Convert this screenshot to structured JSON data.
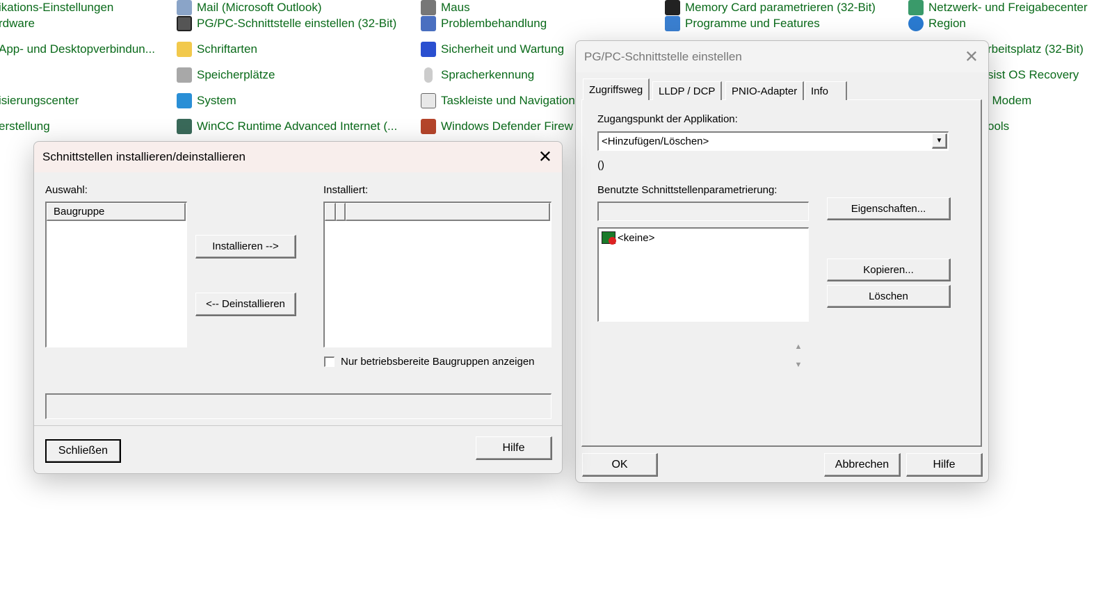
{
  "control_panel": {
    "col0": [
      "ikations-Einstellungen",
      "rdware",
      "App- und Desktopverbindun...",
      "",
      "isierungscenter",
      "erstellung"
    ],
    "col1": [
      "Mail (Microsoft Outlook)",
      "PG/PC-Schnittstelle einstellen (32-Bit)",
      "Schriftarten",
      "Speicherplätze",
      "System",
      "WinCC Runtime Advanced Internet (..."
    ],
    "col2": [
      "Maus",
      "Problembehandlung",
      "Sicherheit und Wartung",
      "Spracherkennung",
      "Taskleiste und Navigation",
      "Windows Defender Firew"
    ],
    "col3": [
      "Memory Card parametrieren (32-Bit)",
      "Programme und Features"
    ],
    "col4": [
      "Netzwerk- und Freigabecenter",
      "Region"
    ],
    "col4_partial": [
      "rbeitsplatz (32-Bit)",
      "sist OS Recovery",
      "l Modem",
      "ools"
    ]
  },
  "install_dialog": {
    "title": "Schnittstellen installieren/deinstallieren",
    "auswahl_label": "Auswahl:",
    "auswahl_header": "Baugruppe",
    "installiert_label": "Installiert:",
    "install_button": "Installieren -->",
    "uninstall_button": "<-- Deinstallieren",
    "checkbox_label": "Nur betriebsbereite Baugruppen anzeigen",
    "checkbox_checked": false,
    "close_button": "Schließen",
    "help_button": "Hilfe"
  },
  "pgpc_dialog": {
    "title": "PG/PC-Schnittstelle einstellen",
    "tabs": [
      "Zugriffsweg",
      "LLDP / DCP",
      "PNIO-Adapter",
      "Info"
    ],
    "active_tab": "Zugriffsweg",
    "access_point_label": "Zugangspunkt der Applikation:",
    "access_point_value": "<Hinzufügen/Löschen>",
    "paren_text": "()",
    "used_param_label": "Benutzte Schnittstellenparametrierung:",
    "used_param_value": "",
    "list_items": [
      "<keine>"
    ],
    "properties_button": "Eigenschaften...",
    "copy_button": "Kopieren...",
    "delete_button": "Löschen",
    "ok_button": "OK",
    "cancel_button": "Abbrechen",
    "help_button": "Hilfe"
  },
  "colors": {
    "link": "#0a6a1a",
    "dialog_bg": "#f0f0f0"
  }
}
